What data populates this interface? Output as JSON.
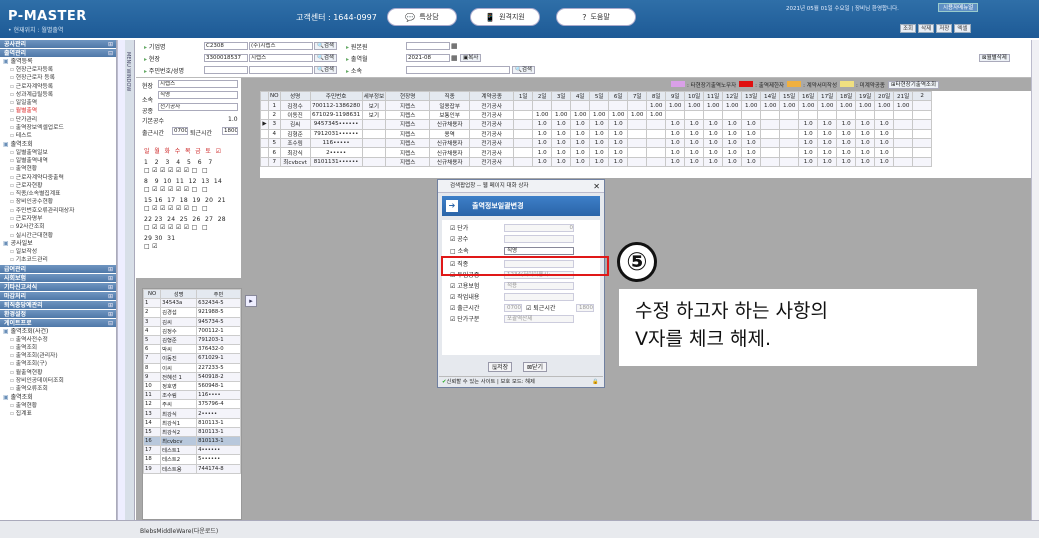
{
  "app": {
    "title": "P-MASTER",
    "breadcrumb": "• 현재위치 : 월별출역"
  },
  "header": {
    "center": "고객센터 : 1644-0997",
    "buttons": [
      {
        "label": "특상담",
        "icon": "chat-bubble-icon"
      },
      {
        "label": "원격지원",
        "icon": "remote-support-icon"
      },
      {
        "label": "도움말",
        "icon": "help-icon"
      }
    ],
    "date_greeting": "2021년 05월 01일 수요일 | 장비님 환영합니다.",
    "menu_button": "시용자메뉴얼",
    "tools": [
      "조회",
      "삭제",
      "저장",
      "엑셀"
    ]
  },
  "sidebar": {
    "sections": [
      {
        "label": "공사관리"
      },
      {
        "label": "출역관리"
      },
      {
        "label": "급여관리"
      },
      {
        "label": "사회보험"
      },
      {
        "label": "기타신고서식"
      },
      {
        "label": "마감처리"
      },
      {
        "label": "퇴직충당예관리"
      },
      {
        "label": "환경설정"
      },
      {
        "label": "게이트프로"
      }
    ],
    "groupA": "출역등록",
    "itemsA": [
      "현장근로자등록",
      "현장근로자 등록",
      "근로자계약등록",
      "성과계급릴등록",
      "일일출역",
      "월별출역",
      "단가관리",
      "출역장보엑셀업로드",
      "테스트"
    ],
    "groupB": "출역조회",
    "itemsB": [
      "일별출역일보",
      "일별출역내역",
      "출역현황",
      "근로자계약다중출력",
      "근로자현황",
      "직종/소속별집계표",
      "장비인공수현황",
      "주민번호오류관리대상자",
      "근로자명부",
      "92사간조회",
      "실시간근대현황"
    ],
    "groupC": "공사일보",
    "itemsC": [
      "일보작성",
      "기초코드관리"
    ],
    "groupD": "출역조회(사건)",
    "itemsD": [
      "출역사전수정",
      "출역조회",
      "출역조회(관리자)",
      "출역조회(구)",
      "월출역현황",
      "장비인공데이터조회",
      "출역오류조회"
    ],
    "groupE": "출역조회",
    "itemsE": [
      "출역현황",
      "집계표"
    ]
  },
  "sidetab": "MENU WINDOW",
  "form": {
    "company_label": "기업명",
    "company_code": "C2308",
    "company_name": "(주)지렙스",
    "site_label": "현장",
    "site_code": "3300018537",
    "site_name": "지렙스",
    "ssn_label": "주민번호/성명",
    "search": "검색",
    "dept_label": "원본원",
    "month_label": "출역월",
    "month_value": "2021-08",
    "copy_btn": "복사",
    "belong_label": "소속",
    "monthly_delete": "월별삭제"
  },
  "legend": [
    {
      "label": ": 타현장기출역노무자",
      "color": "#d9a0e8"
    },
    {
      "label": ": 출역제한자",
      "color": "#e01010"
    },
    {
      "label": ": 계약서미작성",
      "color": "#f0b040"
    },
    {
      "label": ": 미계약공종",
      "color": "#f0e080"
    }
  ],
  "legend_btn": "타현장기출역조회",
  "filter": {
    "site_lbl": "현장",
    "site_val": "지렙스",
    "belong_lbl": "소속",
    "belong_val": "직영",
    "trade_lbl": "공종",
    "trade_val": "전기공사",
    "base_lbl": "기본공수",
    "base_val": "1.0",
    "in_lbl": "출근시간",
    "in_val": "0700",
    "out_lbl": "퇴근시간",
    "out_val": "1800",
    "weekdays": "일  월  화  수  목  금  토  ☑",
    "cal1": "1   2   3   4   5   6   7",
    "cal2": "8   9  10  11  12  13  14",
    "cal3": "15 16  17  18  19  20  21",
    "cal4": "22 23  24  25  26  27  28",
    "cal5": "29 30  31",
    "chk1": "□ ☑ ☑ ☑ ☑ ☑ □  □",
    "chk2": "□ ☑ ☑ ☑ ☑ ☑ □  □",
    "chk3": "□ ☑ ☑ ☑ ☑ ☑ □  □",
    "chk4": "□ ☑ ☑ ☑ ☑ ☑ □  □",
    "chk5": "□ ☑"
  },
  "small_list": {
    "headers": [
      "NO",
      "성명",
      "주민"
    ],
    "rows": [
      [
        "1",
        "34543a",
        "632434-5"
      ],
      [
        "2",
        "김경섭",
        "921988-5"
      ],
      [
        "3",
        "김씨",
        "945734-5"
      ],
      [
        "4",
        "김정수",
        "700112-1"
      ],
      [
        "5",
        "김형준",
        "791203-1"
      ],
      [
        "6",
        "박씨",
        "376432-0"
      ],
      [
        "7",
        "이동진",
        "671029-1"
      ],
      [
        "8",
        "이씨",
        "227233-5"
      ],
      [
        "9",
        "전혜선 1",
        "540918-2"
      ],
      [
        "10",
        "정호영",
        "560948-1"
      ],
      [
        "11",
        "조수림",
        "116••••"
      ],
      [
        "12",
        "주씨",
        "375796-4"
      ],
      [
        "13",
        "최강식",
        "2•••••"
      ],
      [
        "14",
        "최강식1",
        "810113-1"
      ],
      [
        "15",
        "최강식2",
        "810113-1"
      ],
      [
        "16",
        "최cvbcv",
        "810113-1"
      ],
      [
        "17",
        "테스트1",
        "4••••••"
      ],
      [
        "18",
        "테스트2",
        "5••••••"
      ],
      [
        "19",
        "테스트용",
        "744174-8"
      ]
    ]
  },
  "grid": {
    "headers": [
      "NO",
      "성명",
      "주민번호",
      "세부정보",
      "현장명",
      "직종",
      "계약공종",
      "1일",
      "2일",
      "3일",
      "4일",
      "5일",
      "6일",
      "7일",
      "8일",
      "9일",
      "10일",
      "11일",
      "12일",
      "13일",
      "14일",
      "15일",
      "16일",
      "17일",
      "18일",
      "19일",
      "20일",
      "21일",
      "2"
    ],
    "rows": [
      [
        "1",
        "김정수",
        "700112-1386280",
        "보기",
        "지렙스",
        "일용잡부",
        "전기공사",
        "",
        "",
        "",
        "",
        "",
        "",
        "",
        "1.00",
        "1.00",
        "1.00",
        "1.00",
        "1.00",
        "1.00",
        "1.00",
        "1.00",
        "1.00",
        "1.00",
        "1.00",
        "1.00",
        "1.00",
        "1.00",
        ""
      ],
      [
        "2",
        "이동진",
        "671029-1198631",
        "보기",
        "지렙스",
        "보통인부",
        "전기공사",
        "",
        "1.00",
        "1.00",
        "1.00",
        "1.00",
        "1.00",
        "1.00",
        "1.00",
        "",
        "",
        "",
        "",
        "",
        "",
        "",
        "",
        "",
        "",
        "",
        "",
        "",
        ""
      ],
      [
        "3",
        "김씨",
        "9457345••••••",
        "",
        "지렙스",
        "신규채용자",
        "전기공사",
        "",
        "1.0",
        "1.0",
        "1.0",
        "1.0",
        "1.0",
        "",
        "",
        "1.0",
        "1.0",
        "1.0",
        "1.0",
        "1.0",
        "",
        "",
        "1.0",
        "1.0",
        "1.0",
        "1.0",
        "1.0",
        "",
        ""
      ],
      [
        "4",
        "김형준",
        "7912031••••••",
        "",
        "지렙스",
        "용역",
        "전기공사",
        "",
        "1.0",
        "1.0",
        "1.0",
        "1.0",
        "1.0",
        "",
        "",
        "1.0",
        "1.0",
        "1.0",
        "1.0",
        "1.0",
        "",
        "",
        "1.0",
        "1.0",
        "1.0",
        "1.0",
        "1.0",
        "",
        ""
      ],
      [
        "5",
        "조수림",
        "116•••••",
        "",
        "지렙스",
        "신규채용자",
        "전기공사",
        "",
        "1.0",
        "1.0",
        "1.0",
        "1.0",
        "1.0",
        "",
        "",
        "1.0",
        "1.0",
        "1.0",
        "1.0",
        "1.0",
        "",
        "",
        "1.0",
        "1.0",
        "1.0",
        "1.0",
        "1.0",
        "",
        ""
      ],
      [
        "6",
        "최강식",
        "2•••••",
        "",
        "지렙스",
        "신규채용자",
        "전기공사",
        "",
        "1.0",
        "1.0",
        "1.0",
        "1.0",
        "1.0",
        "",
        "",
        "1.0",
        "1.0",
        "1.0",
        "1.0",
        "1.0",
        "",
        "",
        "1.0",
        "1.0",
        "1.0",
        "1.0",
        "1.0",
        "",
        ""
      ],
      [
        "7",
        "최cvbcvt",
        "8101131••••••",
        "",
        "지렙스",
        "신규채용자",
        "전기공사",
        "",
        "1.0",
        "1.0",
        "1.0",
        "1.0",
        "1.0",
        "",
        "",
        "1.0",
        "1.0",
        "1.0",
        "1.0",
        "1.0",
        "",
        "",
        "1.0",
        "1.0",
        "1.0",
        "1.0",
        "1.0",
        "",
        ""
      ]
    ]
  },
  "dialog": {
    "titlebar": "검색팝업창 -- 웹 페이지 대화 상자",
    "header": "출역정보일괄변경",
    "rows": [
      {
        "label": "☑ 단가",
        "value": "0"
      },
      {
        "label": "☑ 공수",
        "value": ""
      },
      {
        "label": "□ 소속",
        "value": "직영"
      },
      {
        "label": "☑ 직종",
        "value": ""
      },
      {
        "label": "☑ 투입공종",
        "value": "1234(저이이용시:"
      },
      {
        "label": "☑ 고용보험",
        "value": "적용"
      },
      {
        "label": "☑ 작업내용",
        "value": ""
      },
      {
        "label": "☑ 출근시간",
        "value": "0700"
      },
      {
        "label": "☑ 단가구분",
        "value": "포괄역산제"
      }
    ],
    "out_label": "☑ 퇴근시간",
    "out_value": "1800",
    "save": "저장",
    "close": "닫기",
    "status": "신뢰할 수 있는 사이트 | 보호 모드: 해제"
  },
  "annotation": {
    "number": "⑤",
    "text1": "수정 하고자 하는 사항의",
    "text2": "V자를 체크 해제."
  },
  "footer": "BlebsMiddleWare(다운로드)"
}
